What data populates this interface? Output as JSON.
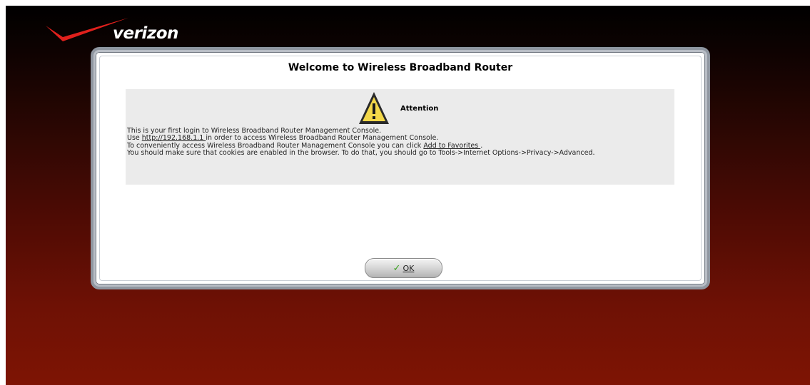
{
  "brand": {
    "logo_text": "verizon"
  },
  "dialog": {
    "title": "Welcome to Wireless Broadband Router",
    "attention_label": "Attention",
    "line1": "This is your first login to Wireless Broadband Router Management Console.",
    "line2_prefix": "Use ",
    "line2_link": "http://192.168.1.1 ",
    "line2_suffix": "in order to access Wireless Broadband Router Management Console.",
    "line3_prefix": "To conveniently access Wireless Broadband Router Management Console you can click ",
    "line3_link": "Add to Favorites ",
    "line3_suffix": ".",
    "line4": "You should make sure that cookies are enabled in the browser. To do that, you should go to Tools->Internet Options->Privacy->Advanced.",
    "ok_label": "OK"
  },
  "colors": {
    "background_top": "#000000",
    "background_bottom": "#7e1404",
    "logo_check": "#e0201c",
    "ok_check": "#3aa31f"
  },
  "icons": [
    "verizon-check-icon",
    "warning-triangle-icon",
    "checkmark-icon"
  ]
}
